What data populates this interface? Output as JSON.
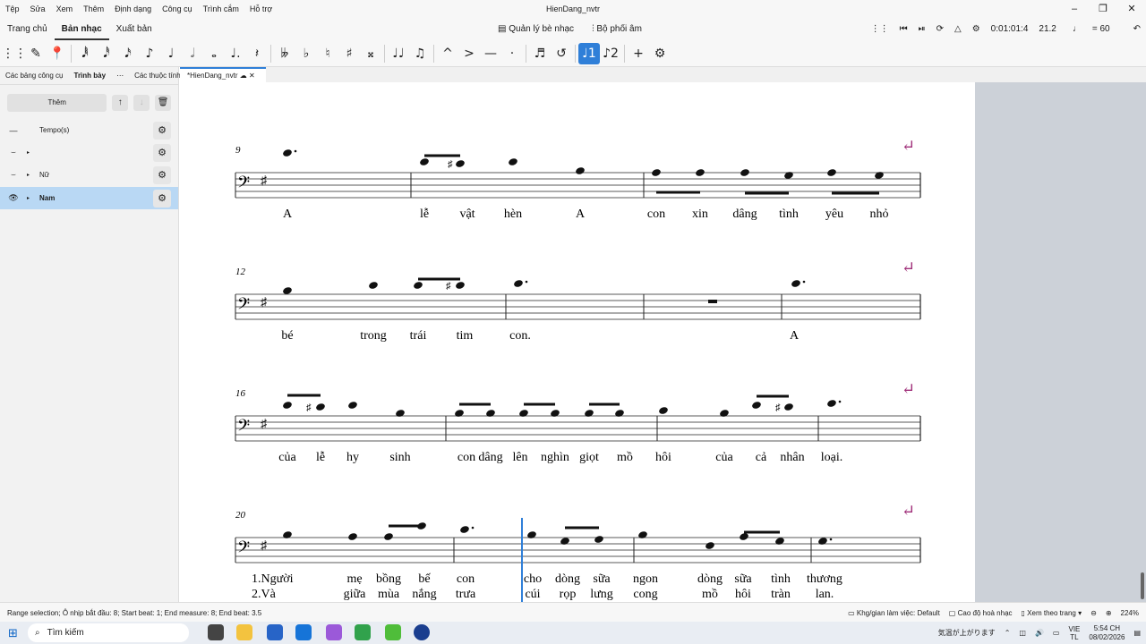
{
  "menu": {
    "items": [
      "Tệp",
      "Sửa",
      "Xem",
      "Thêm",
      "Định dạng",
      "Công cụ",
      "Trình cắm",
      "Hỗ trợ"
    ],
    "title": "HienDang_nvtr"
  },
  "tabs": {
    "items": [
      "Trang chủ",
      "Bản nhạc",
      "Xuất bản"
    ],
    "active": 1
  },
  "center_buttons": {
    "parts": "Quản lý bè nhạc",
    "mixer": "Bộ phối âm"
  },
  "playback": {
    "time": "0:01:01:4",
    "position": "21.2",
    "tempo": "= 60"
  },
  "toolbar": {
    "icons": [
      "grip-icon",
      "pencil-icon",
      "pin-icon",
      "note-64th-icon",
      "note-32nd-icon",
      "note-16th-icon",
      "note-8th-icon",
      "note-quarter-icon",
      "note-half-icon",
      "note-whole-icon",
      "dot-icon",
      "rest-icon",
      "double-flat-icon",
      "flat-icon",
      "natural-icon",
      "sharp-icon",
      "double-sharp-icon",
      "tie-icon",
      "slur-icon",
      "marcato-icon",
      "accent-icon",
      "tenuto-icon",
      "staccato-icon",
      "beam-icon",
      "flip-icon",
      "voice-1-icon",
      "voice-2-icon",
      "add-icon",
      "settings-icon"
    ],
    "glyphs": [
      "⋮⋮",
      "✎",
      "📍",
      "𝅘𝅥𝅱",
      "𝅘𝅥𝅰",
      "𝅘𝅥𝅯",
      "♪",
      "♩",
      "𝅗𝅥",
      "𝅝",
      "♩.",
      "𝄽",
      "𝄫",
      "♭",
      "♮",
      "♯",
      "𝄪",
      "♩♩",
      "♫",
      "^",
      ">",
      "—",
      "·",
      "♬",
      "↺",
      "♩1",
      "♪2",
      "+",
      "⚙"
    ]
  },
  "left_panel": {
    "tabs": [
      "Các bảng công cụ",
      "Trình bày",
      "Các thuộc tính"
    ],
    "active_tab": 1,
    "add_label": "Thêm",
    "rows": [
      {
        "label": "Tempo(s)",
        "icon": "line-icon"
      },
      {
        "label": "",
        "icon": "eye-closed-icon"
      },
      {
        "label": "Nữ",
        "icon": "eye-closed-icon"
      },
      {
        "label": "Nam",
        "icon": "eye-icon",
        "selected": true
      }
    ]
  },
  "document": {
    "tab_title": "*HienDang_nvtr"
  },
  "score": {
    "systems": [
      {
        "measure": "9",
        "lyrics": [
          [
            "A"
          ],
          [
            "lễ",
            "vật",
            "hèn"
          ],
          [
            "A"
          ],
          [
            "con",
            "xin",
            "dâng",
            "tình",
            "yêu",
            "nhỏ"
          ]
        ]
      },
      {
        "measure": "12",
        "lyrics": [
          [
            "bé",
            "trong",
            "trái",
            "tim"
          ],
          [
            "con."
          ],
          [
            "A"
          ]
        ]
      },
      {
        "measure": "16",
        "lyrics": [
          [
            "của",
            "lễ",
            "hy",
            "sinh"
          ],
          [
            "con",
            "dâng",
            "lên",
            "nghìn",
            "giọt",
            "mồ"
          ],
          [
            "hôi",
            "của",
            "cả",
            "nhân"
          ],
          [
            "loại."
          ]
        ]
      },
      {
        "measure": "20",
        "verse1": [
          "1.Người",
          "mẹ",
          "bồng",
          "bế",
          "con",
          "cho",
          "dòng",
          "sữa",
          "ngon",
          "dòng",
          "sữa",
          "tình",
          "thương"
        ],
        "verse2": [
          "2.Và",
          "giữa",
          "mùa",
          "nắng",
          "trưa",
          "cúi",
          "rọp",
          "lưng",
          "cong",
          "mồ",
          "hôi",
          "tràn",
          "lan."
        ]
      }
    ]
  },
  "status": {
    "left": "Range selection; Ô nhịp bắt đầu: 8; Start beat: 1; End measure: 8; End beat: 3.5",
    "workspace": "Khg/gian làm việc: Default",
    "concert": "Cao độ hoà nhạc",
    "view": "Xem theo trang",
    "zoom": "224%"
  },
  "taskbar": {
    "search": "Tìm kiếm",
    "weather": "気温が上がります",
    "lang1": "VIE",
    "lang2": "TL",
    "clock": "5:54 CH",
    "date": "08/02/2026"
  },
  "colors": {
    "accent": "#2f7fd8",
    "break_mark": "#a0307a"
  }
}
